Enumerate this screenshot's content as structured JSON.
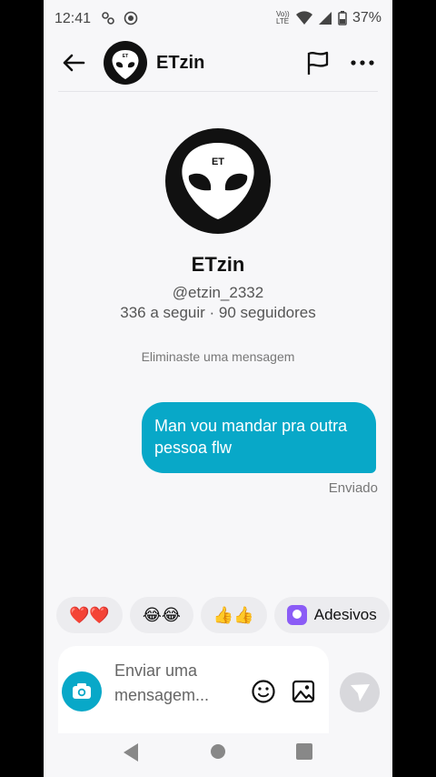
{
  "status_bar": {
    "time": "12:41",
    "network": "Vo)) LTE",
    "battery": "37%"
  },
  "header": {
    "name": "ETzin",
    "icons": [
      "back-arrow-icon",
      "avatar",
      "flag-icon",
      "more-icon"
    ]
  },
  "profile": {
    "avatar_text": "ET",
    "header_avatar_text": "ET",
    "name": "ETzin",
    "handle": "@etzin_2332",
    "stats": "336 a seguir · 90 seguidores"
  },
  "chat": {
    "system_message": "Eliminaste uma mensagem",
    "messages": [
      {
        "text": "Man vou mandar pra outra pessoa flw",
        "status": "Enviado"
      }
    ]
  },
  "reactions": [
    {
      "label": "❤️❤️"
    },
    {
      "label": "😂😂"
    },
    {
      "label": "👍👍"
    },
    {
      "label": "Adesivos"
    }
  ],
  "composer": {
    "placeholder": "Enviar uma mensagem...",
    "colors": {
      "accent": "#08a8c8",
      "send_disabled": "#d8d8dc"
    }
  }
}
